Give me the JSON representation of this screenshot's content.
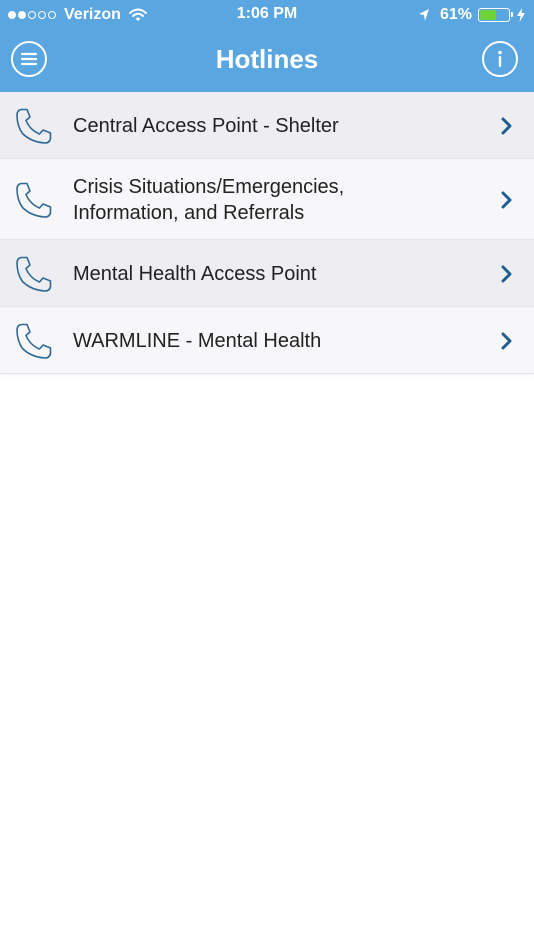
{
  "status_bar": {
    "carrier": "Verizon",
    "signal_filled": 2,
    "signal_total": 5,
    "time": "1:06 PM",
    "battery_percent_label": "61%",
    "battery_level": 0.61,
    "icons": [
      "wifi-icon",
      "location-arrow-icon",
      "battery-icon",
      "charging-bolt-icon"
    ]
  },
  "nav": {
    "title": "Hotlines",
    "left_icon": "menu-icon",
    "right_icon": "info-icon"
  },
  "hotlines": [
    {
      "label": "Central Access Point - Shelter",
      "icon": "phone-icon"
    },
    {
      "label": "Crisis Situations/Emergencies,\nInformation, and Referrals",
      "icon": "phone-icon"
    },
    {
      "label": "Mental Health Access Point",
      "icon": "phone-icon"
    },
    {
      "label": "WARMLINE - Mental Health",
      "icon": "phone-icon"
    }
  ],
  "colors": {
    "nav_background": "#5aa6e0",
    "row_odd": "#ededf2",
    "row_even": "#f7f7fa",
    "chevron": "#1f5f8f",
    "phone_icon": "#2d6a96",
    "battery_fill": "#6fd33c"
  }
}
